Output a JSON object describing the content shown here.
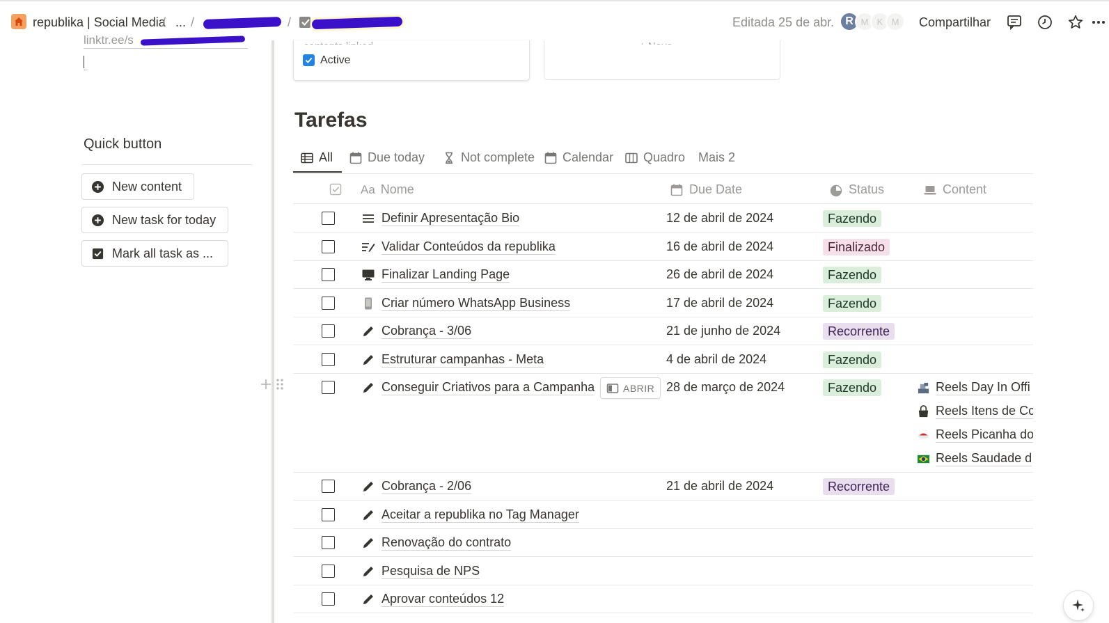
{
  "breadcrumb": {
    "workspace": "republika | Social Media",
    "sep": "/",
    "ellipsis": "..."
  },
  "topbar": {
    "edited": "Editada 25 de abr.",
    "avatars": [
      "R",
      "M",
      "K",
      "M"
    ],
    "share": "Compartilhar"
  },
  "left": {
    "link_text": "linktr.ee/s",
    "quick_title": "Quick button",
    "buttons": [
      {
        "label": "New content"
      },
      {
        "label": "New task for today"
      },
      {
        "label": "Mark all task as ..."
      }
    ]
  },
  "cards": {
    "card1_cut": "contents linked",
    "card2_cut": "+ Novo",
    "active": "Active"
  },
  "tasks": {
    "title": "Tarefas",
    "tabs": [
      "All",
      "Due today",
      "Not complete",
      "Calendar",
      "Quadro",
      "Mais 2"
    ],
    "columns": {
      "name_prefix": "Aa",
      "name": "Nome",
      "due": "Due Date",
      "status": "Status",
      "content": "Content"
    },
    "open_label": "ABRIR",
    "rows": [
      {
        "icon": "list-icon",
        "name": "Definir Apresentação Bio",
        "date": "12 de abril de 2024",
        "status": "Fazendo"
      },
      {
        "icon": "edit-list-icon",
        "name": "Validar Conteúdos da republika",
        "date": "16 de abril de 2024",
        "status": "Finalizado"
      },
      {
        "icon": "monitor-icon",
        "name": "Finalizar Landing Page",
        "date": "26 de abril de 2024",
        "status": "Fazendo"
      },
      {
        "icon": "phone-icon",
        "name": "Criar número WhatsApp Business",
        "date": "17 de abril de 2024",
        "status": "Fazendo"
      },
      {
        "icon": "pencil-icon",
        "name": "Cobrança - 3/06",
        "date": "21 de junho de 2024",
        "status": "Recorrente"
      },
      {
        "icon": "pencil-icon",
        "name": "Estruturar campanhas - Meta",
        "date": "4 de abril de 2024",
        "status": "Fazendo"
      },
      {
        "icon": "pencil-icon",
        "name": "Conseguir Criativos para a Campanha",
        "date": "28 de março de 2024",
        "status": "Fazendo",
        "content": [
          "Reels Day In Offi",
          "Reels Itens de Cc",
          "Reels Picanha do",
          "Reels Saudade d"
        ]
      },
      {
        "icon": "pencil-icon",
        "name": "Cobrança - 2/06",
        "date": "21 de abril de 2024",
        "status": "Recorrente"
      },
      {
        "icon": "pencil-icon",
        "name": "Aceitar a republika no Tag Manager",
        "date": "",
        "status": ""
      },
      {
        "icon": "pencil-icon",
        "name": "Renovação do contrato",
        "date": "",
        "status": ""
      },
      {
        "icon": "pencil-icon",
        "name": "Pesquisa de NPS",
        "date": "",
        "status": ""
      },
      {
        "icon": "pencil-icon",
        "name": "Aprovar conteúdos 12",
        "date": "",
        "status": ""
      }
    ]
  },
  "colors": {
    "accent": "#2383e2",
    "fazendo_bg": "#dbeddb",
    "finalizado_bg": "#f5e0e9",
    "recorrente_bg": "#e8deee"
  }
}
